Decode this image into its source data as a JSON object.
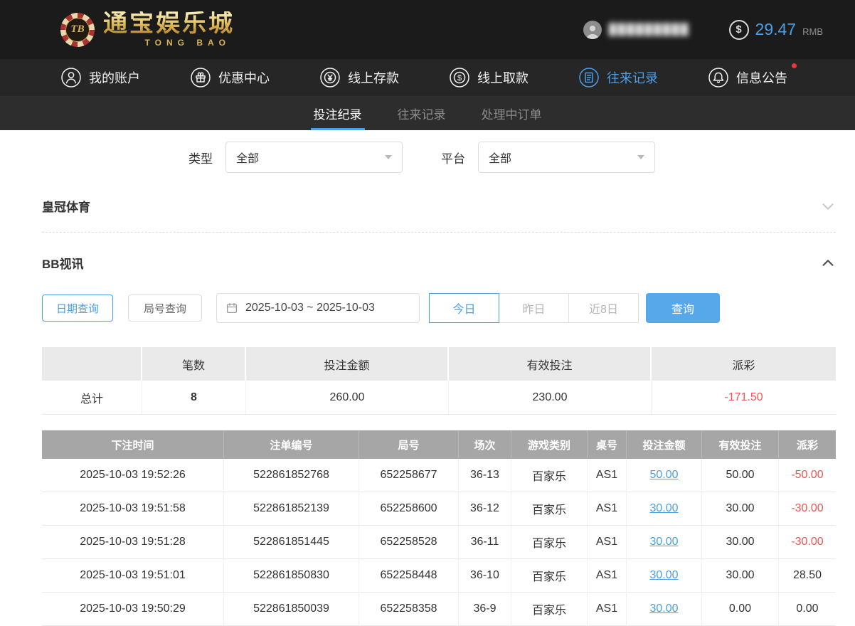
{
  "brand": {
    "badge": "TB",
    "name": "通宝娱乐城",
    "subtitle": "TONG BAO"
  },
  "user": {
    "masked": "█████████"
  },
  "header": {
    "balance": "29.47",
    "currency": "RMB",
    "dollar": "$"
  },
  "nav": {
    "items": [
      {
        "label": "我的账户",
        "icon": "user-icon"
      },
      {
        "label": "优惠中心",
        "icon": "gift-icon"
      },
      {
        "label": "线上存款",
        "icon": "coin-yuan-icon"
      },
      {
        "label": "线上取款",
        "icon": "coin-dollar-icon"
      },
      {
        "label": "往来记录",
        "icon": "records-icon",
        "active": true
      },
      {
        "label": "信息公告",
        "icon": "bell-icon",
        "badge": true
      }
    ]
  },
  "tabs": [
    {
      "label": "投注纪录",
      "active": true
    },
    {
      "label": "往来记录",
      "active": false
    },
    {
      "label": "处理中订单",
      "active": false
    }
  ],
  "filters": {
    "type_label": "类型",
    "type_value": "全部",
    "platform_label": "平台",
    "platform_value": "全部"
  },
  "sections": {
    "crown": "皇冠体育",
    "bb": "BB视讯"
  },
  "query": {
    "date_query": "日期查询",
    "round_query": "局号查询",
    "date_range": "2025-10-03 ~ 2025-10-03",
    "today": "今日",
    "yesterday": "昨日",
    "last8": "近8日",
    "search": "查询"
  },
  "summary": {
    "headers": [
      "",
      "笔数",
      "投注金额",
      "有效投注",
      "派彩"
    ],
    "total_label": "总计",
    "count": "8",
    "bet_amount": "260.00",
    "valid_bet": "230.00",
    "payout": "-171.50"
  },
  "bets": {
    "headers": [
      "下注时间",
      "注单编号",
      "局号",
      "场次",
      "游戏类别",
      "桌号",
      "投注金额",
      "有效投注",
      "派彩"
    ],
    "rows": [
      {
        "time": "2025-10-03 19:52:26",
        "id": "522861852768",
        "round": "652258677",
        "session": "36-13",
        "game": "百家乐",
        "table": "AS1",
        "amount": "50.00",
        "valid": "50.00",
        "payout": "-50.00"
      },
      {
        "time": "2025-10-03 19:51:58",
        "id": "522861852139",
        "round": "652258600",
        "session": "36-12",
        "game": "百家乐",
        "table": "AS1",
        "amount": "30.00",
        "valid": "30.00",
        "payout": "-30.00"
      },
      {
        "time": "2025-10-03 19:51:28",
        "id": "522861851445",
        "round": "652258528",
        "session": "36-11",
        "game": "百家乐",
        "table": "AS1",
        "amount": "30.00",
        "valid": "30.00",
        "payout": "-30.00"
      },
      {
        "time": "2025-10-03 19:51:01",
        "id": "522861850830",
        "round": "652258448",
        "session": "36-10",
        "game": "百家乐",
        "table": "AS1",
        "amount": "30.00",
        "valid": "30.00",
        "payout": "28.50"
      },
      {
        "time": "2025-10-03 19:50:29",
        "id": "522861850039",
        "round": "652258358",
        "session": "36-9",
        "game": "百家乐",
        "table": "AS1",
        "amount": "30.00",
        "valid": "0.00",
        "payout": "0.00"
      }
    ]
  },
  "colors": {
    "accent": "#4a9fe8",
    "negative": "#f25555",
    "gold": "#d8b452"
  }
}
